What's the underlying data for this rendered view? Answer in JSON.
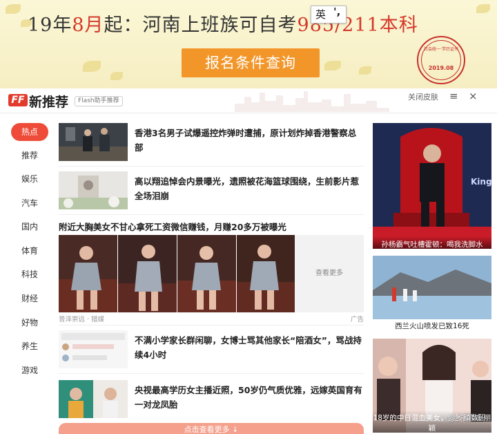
{
  "banner": {
    "headline_pre": "19年",
    "headline_month": "8月",
    "headline_post": "起：河南上班族可自考",
    "headline_tail": "985/211本科",
    "button_label": "报名条件查询",
    "stamp_text": "社会统一·学历证书",
    "stamp_date": "2019.08"
  },
  "ime": {
    "key1": "英",
    "key2": "',"
  },
  "header": {
    "logo_badge": "FF",
    "logo_title": "新推荐",
    "flash_tag": "Flash助手推荐",
    "close_skin": "关闭皮肤",
    "menu_btn": "≡",
    "close_btn": "×"
  },
  "nav": {
    "items": [
      "热点",
      "推荐",
      "娱乐",
      "汽车",
      "国内",
      "体育",
      "科技",
      "财经",
      "好物",
      "养生",
      "游戏"
    ]
  },
  "feed": {
    "news": [
      "香港3名男子试爆遥控炸弹时遭捕，原计划炸掉香港警察总部",
      "高以翔追悼会内景曝光，遗照被花海篮球围绕，生前影片惹全场泪崩",
      "不满小学家长群闲聊，女博士骂其他家长“陪酒女”，骂战持续4小时",
      "央视最高学历女主播近照，50岁仍气质优雅，远嫁英国育有一对龙凤胎"
    ],
    "ad": {
      "title": "附近大胸美女不甘心拿死工资微信赚钱，月赚20多万被曝光",
      "more_label": "查看更多",
      "source": "普泽崇远 · 猎媒",
      "ad_label": "广告"
    },
    "load_more": "点击查看更多 ↓"
  },
  "right": {
    "cards": [
      {
        "caption": "孙杨霸气吐槽霍顿：喝我洗脚水",
        "sign_text": "King"
      },
      {
        "caption": "西兰火山喷发已致16死"
      },
      {
        "caption": "18岁的中日混血美女，竟然神似赵丽颖"
      }
    ]
  },
  "watermark": "@乡镇数码"
}
